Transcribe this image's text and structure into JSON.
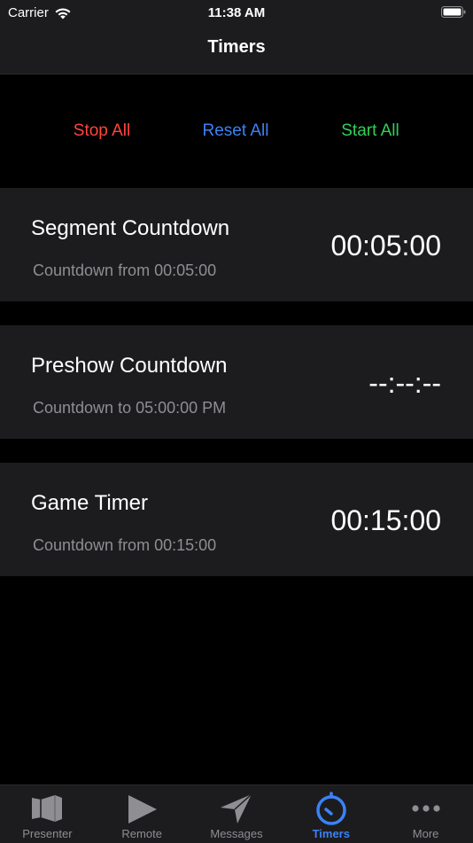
{
  "status_bar": {
    "carrier": "Carrier",
    "time": "11:38 AM",
    "icons": [
      "wifi-icon",
      "battery-icon"
    ]
  },
  "nav": {
    "title": "Timers"
  },
  "actions": {
    "stop_all": "Stop All",
    "reset_all": "Reset All",
    "start_all": "Start All"
  },
  "timers": [
    {
      "name": "Segment Countdown",
      "subtitle": "Countdown from 00:05:00",
      "value": "00:05:00"
    },
    {
      "name": "Preshow Countdown",
      "subtitle": "Countdown to 05:00:00 PM",
      "value": "--:--:--"
    },
    {
      "name": "Game Timer",
      "subtitle": "Countdown from 00:15:00",
      "value": "00:15:00"
    }
  ],
  "tab_bar": {
    "tabs": [
      {
        "label": "Presenter",
        "icon": "presenter-icon",
        "active": false
      },
      {
        "label": "Remote",
        "icon": "play-icon",
        "active": false
      },
      {
        "label": "Messages",
        "icon": "paper-plane-icon",
        "active": false
      },
      {
        "label": "Timers",
        "icon": "timer-icon",
        "active": true
      },
      {
        "label": "More",
        "icon": "ellipsis-icon",
        "active": false
      }
    ]
  },
  "colors": {
    "accent": "#3b82f6",
    "stop": "#ff453a",
    "start": "#30d158",
    "bar_background": "#1c1c1e",
    "secondary_text": "#8e8e93"
  }
}
